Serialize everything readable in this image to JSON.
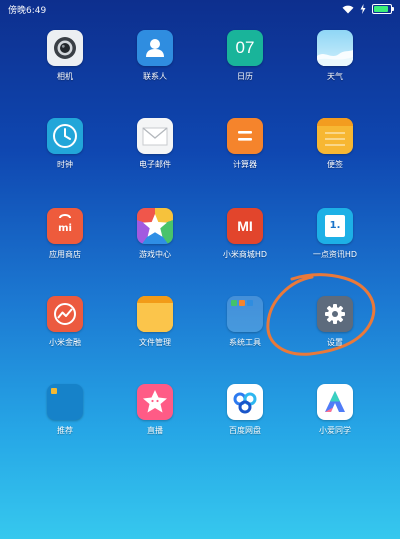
{
  "status_bar": {
    "time": "傍晚6:49"
  },
  "apps": {
    "camera": {
      "label": "相机"
    },
    "contacts": {
      "label": "联系人"
    },
    "calendar": {
      "label": "日历",
      "day": "07"
    },
    "weather": {
      "label": "天气"
    },
    "clock": {
      "label": "时钟"
    },
    "email": {
      "label": "电子邮件"
    },
    "calculator": {
      "label": "计算器"
    },
    "notes": {
      "label": "便签"
    },
    "app_store": {
      "label": "应用商店",
      "badge": "mi"
    },
    "game_center": {
      "label": "游戏中心"
    },
    "mi_store": {
      "label": "小米商城HD",
      "logo": "MI"
    },
    "yidian": {
      "label": "一点资讯HD",
      "badge": "1."
    },
    "mi_finance": {
      "label": "小米金融"
    },
    "file_manager": {
      "label": "文件管理"
    },
    "system_tools": {
      "label": "系统工具"
    },
    "settings": {
      "label": "设置"
    },
    "recommend": {
      "label": "推荐"
    },
    "live": {
      "label": "直播"
    },
    "baidu_pan": {
      "label": "百度网盘"
    },
    "xiaoai": {
      "label": "小爱同学"
    }
  },
  "colors": {
    "annotation_stroke": "#e9793a"
  }
}
